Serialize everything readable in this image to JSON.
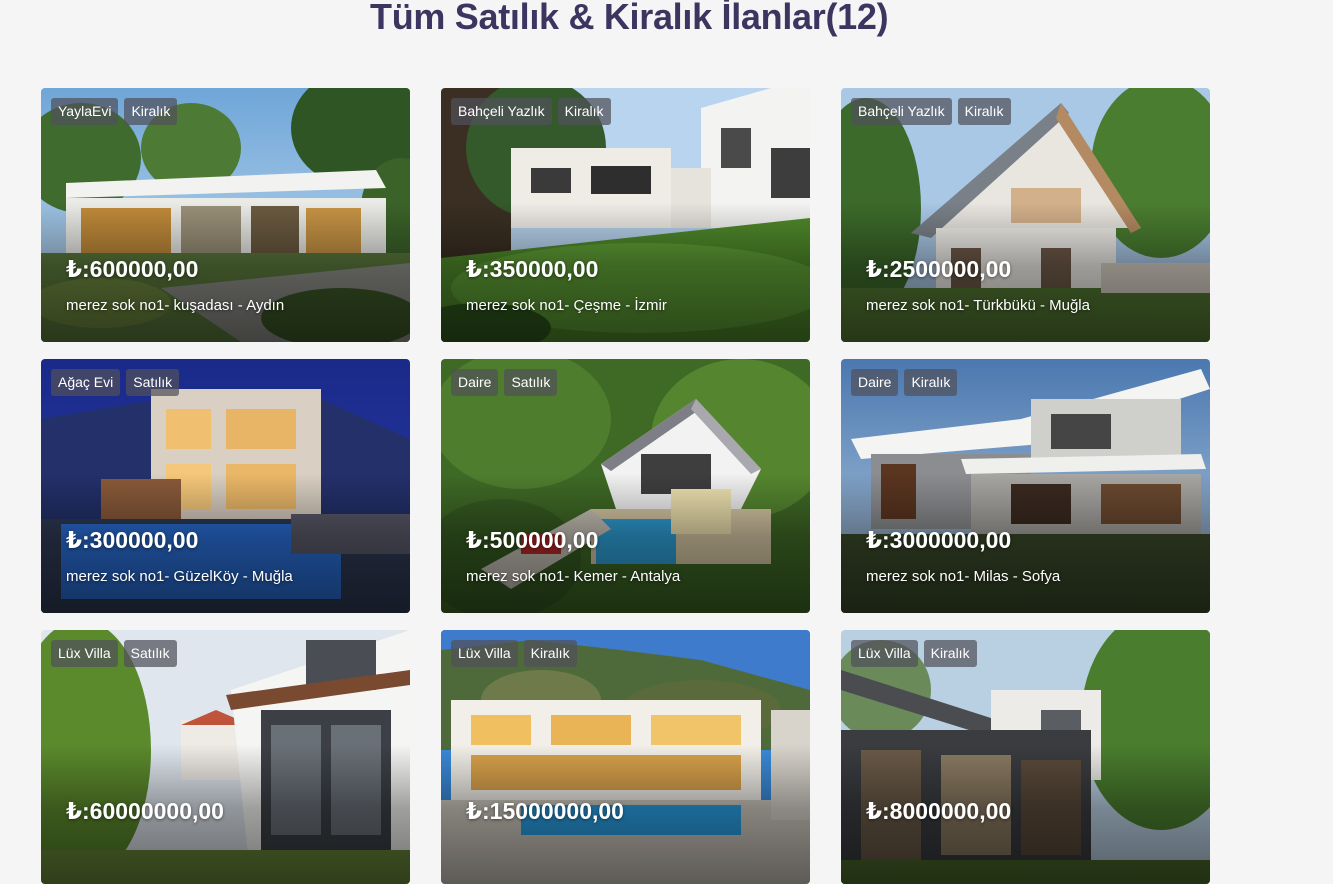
{
  "page": {
    "title": "Tüm Satılık & Kiralık İlanlar(12)"
  },
  "listings": [
    {
      "type": "YaylaEvi",
      "status": "Kiralık",
      "price": "₺:600000,00",
      "address": "merez sok no1- kuşadası - Aydın",
      "scene": "modern-bungalow-pines"
    },
    {
      "type": "Bahçeli Yazlık",
      "status": "Kiralık",
      "price": "₺:350000,00",
      "address": "merez sok no1- Çeşme - İzmir",
      "scene": "houses-with-lawn"
    },
    {
      "type": "Bahçeli Yazlık",
      "status": "Kiralık",
      "price": "₺:2500000,00",
      "address": "merez sok no1- Türkbükü - Muğla",
      "scene": "gabled-house-trees"
    },
    {
      "type": "Ağaç Evi",
      "status": "Satılık",
      "price": "₺:300000,00",
      "address": "merez sok no1- GüzelKöy - Muğla",
      "scene": "night-villa-pool"
    },
    {
      "type": "Daire",
      "status": "Satılık",
      "price": "₺:500000,00",
      "address": "merez sok no1- Kemer - Antalya",
      "scene": "aerial-house-pool"
    },
    {
      "type": "Daire",
      "status": "Kiralık",
      "price": "₺:3000000,00",
      "address": "merez sok no1- Milas - Sofya",
      "scene": "modern-stone-house"
    },
    {
      "type": "Lüx Villa",
      "status": "Satılık",
      "price": "₺:60000000,00",
      "address": "",
      "scene": "white-villa-garden"
    },
    {
      "type": "Lüx Villa",
      "status": "Kiralık",
      "price": "₺:15000000,00",
      "address": "",
      "scene": "hillside-villa-pool"
    },
    {
      "type": "Lüx Villa",
      "status": "Kiralık",
      "price": "₺:8000000,00",
      "address": "",
      "scene": "modern-villa-trees"
    }
  ],
  "colors": {
    "background": "#f5f5f5",
    "title": "#3b3560",
    "tag_background": "rgba(80,80,90,0.72)",
    "overlay_text": "#ffffff"
  }
}
